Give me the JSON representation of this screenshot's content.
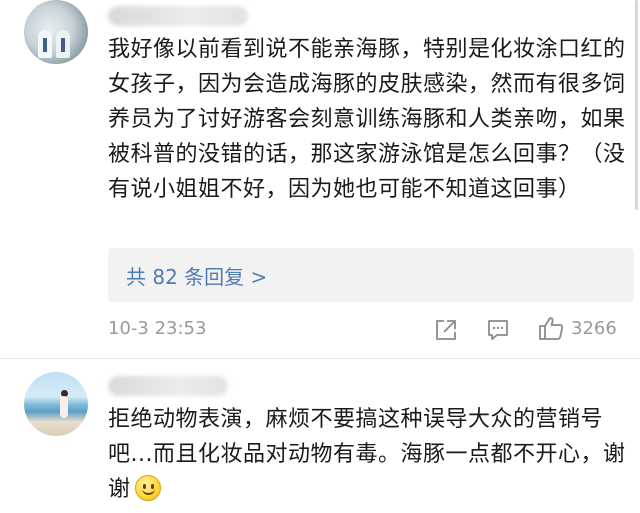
{
  "comments": [
    {
      "text": "我好像以前看到说不能亲海豚，特别是化妆涂口红的女孩子，因为会造成海豚的皮肤感染，然而有很多饲养员为了讨好游客会刻意训练海豚和人类亲吻，如果被科普的没错的话，那这家游泳馆是怎么回事？（没有说小姐姐不好，因为她也可能不知道这回事）",
      "replies_link": "共 82 条回复 >",
      "time": "10-3 23:53",
      "likes": "3266"
    },
    {
      "text": "拒绝动物表演，麻烦不要搞这种误导大众的营销号吧...而且化妆品对动物有毒。海豚一点都不开心，谢谢",
      "emoji": "smile-emoji"
    }
  ],
  "icons": {
    "share": "share-icon",
    "comment": "comment-icon",
    "like": "thumbs-up-icon"
  },
  "colors": {
    "link": "#4f7db3",
    "meta": "#9a9a9a",
    "reply_bg": "#f2f2f2"
  }
}
